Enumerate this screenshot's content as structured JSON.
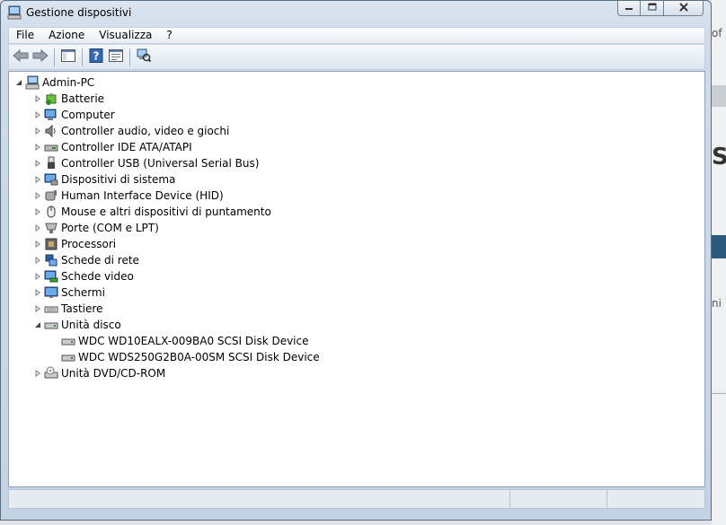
{
  "window": {
    "title": "Gestione dispositivi"
  },
  "caption_buttons": {
    "minimize": "minimize-icon",
    "maximize": "maximize-icon",
    "close": "close-icon"
  },
  "menu": [
    "File",
    "Azione",
    "Visualizza",
    "?"
  ],
  "toolbar_icons": [
    "back-arrow-icon",
    "forward-arrow-icon",
    "show-hide-console-tree-icon",
    "help-icon",
    "properties-icon",
    "scan-hardware-icon"
  ],
  "tree": {
    "root": "Admin-PC",
    "categories": [
      "Batterie",
      "Computer",
      "Controller audio, video e giochi",
      "Controller IDE ATA/ATAPI",
      "Controller USB (Universal Serial Bus)",
      "Dispositivi di sistema",
      "Human Interface Device (HID)",
      "Mouse e altri dispositivi di puntamento",
      "Porte (COM e LPT)",
      "Processori",
      "Schede di rete",
      "Schede video",
      "Schermi",
      "Tastiere",
      "Unità disco",
      "Unità DVD/CD-ROM"
    ],
    "disk_devices": [
      "WDC WD10EALX-009BA0 SCSI Disk Device",
      "WDC WDS250G2B0A-00SM SCSI Disk Device"
    ]
  },
  "background": {
    "fragment_1": "of",
    "fragment_2": "S",
    "fragment_3": "ni"
  }
}
